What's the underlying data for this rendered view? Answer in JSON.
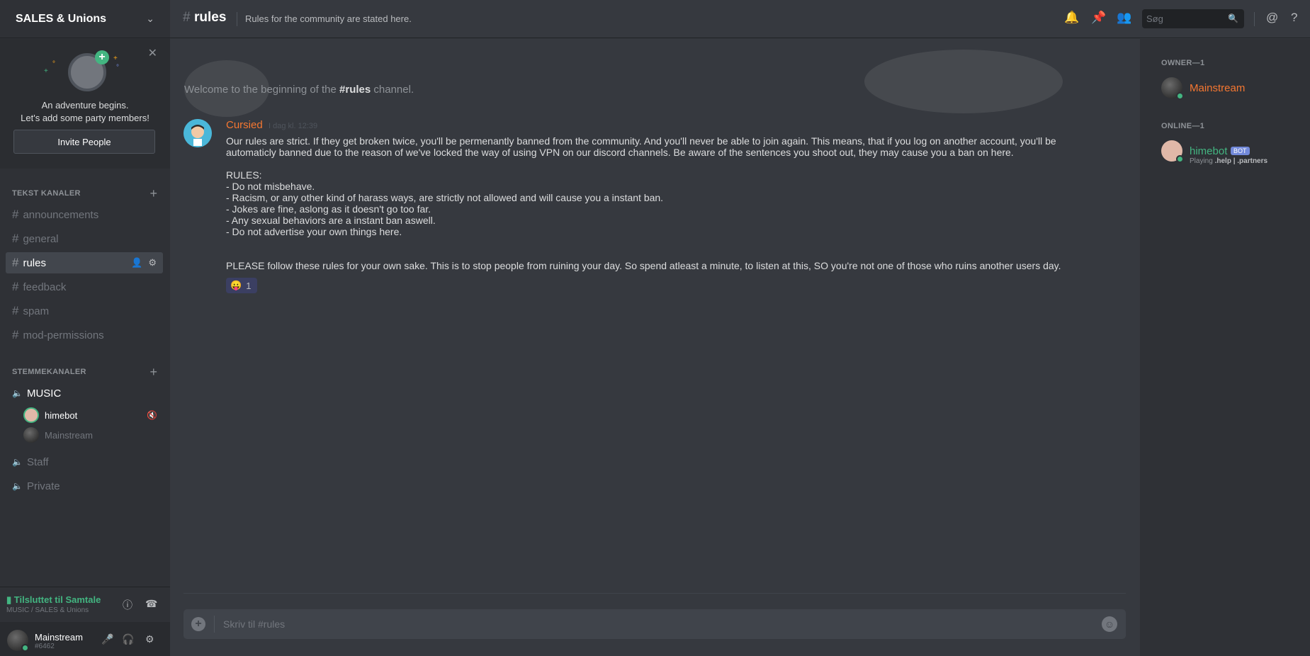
{
  "server": {
    "name": "SALES & Unions"
  },
  "invite": {
    "line1": "An adventure begins.",
    "line2": "Let's add some party members!",
    "button": "Invite People"
  },
  "categories": {
    "text": "TEKST KANALER",
    "voice": "STEMMEKANALER"
  },
  "text_channels": [
    "announcements",
    "general",
    "rules",
    "feedback",
    "spam",
    "mod-permissions"
  ],
  "voice_channels": [
    "MUSIC",
    "Staff",
    "Private"
  ],
  "voice_users": [
    "himebot",
    "Mainstream"
  ],
  "rtc": {
    "status": "Tilsluttet til Samtale",
    "sub": "MUSIC / SALES & Unions"
  },
  "user": {
    "name": "Mainstream",
    "tag": "#6462"
  },
  "channel": {
    "name": "rules",
    "topic": "Rules for the community are stated here."
  },
  "search": {
    "placeholder": "Søg"
  },
  "welcome": {
    "prefix": "Welcome to the beginning of the ",
    "channel": "#rules",
    "suffix": " channel."
  },
  "message": {
    "author": "Cursied",
    "time": "I dag kl. 12:39",
    "para1": "Our rules are strict. If they get broken twice, you'll be permenantly banned from the community. And you'll never be able to join again. This means, that if you log on another account, you'll be automaticly banned due to the reason of we've locked the way of using VPN on our discord channels. Be aware of the sentences you shoot out, they may cause you a ban on here.",
    "rules_title": "RULES:",
    "rules": [
      "- Do not misbehave.",
      "- Racism, or any other kind of harass ways, are strictly not allowed and will cause you a instant ban.",
      "- Jokes are fine, aslong as it doesn't go too far.",
      "- Any sexual behaviors are a instant ban aswell.",
      "- Do not advertise your own things here."
    ],
    "para2": "PLEASE follow these rules for your own sake. This is to stop people from ruining your day. So spend atleast a minute, to listen at this, SO you're not one of those who ruins another users day.",
    "reaction_emoji": "😛",
    "reaction_count": "1"
  },
  "composer": {
    "placeholder": "Skriv til #rules"
  },
  "members": {
    "owner_header": "OWNER—1",
    "online_header": "ONLINE—1",
    "owner": {
      "name": "Mainstream",
      "color": "#f57731"
    },
    "online": {
      "name": "himebot",
      "badge": "BOT",
      "playing": "Playing",
      "game": ".help | .partners",
      "color": "#43b581"
    }
  }
}
